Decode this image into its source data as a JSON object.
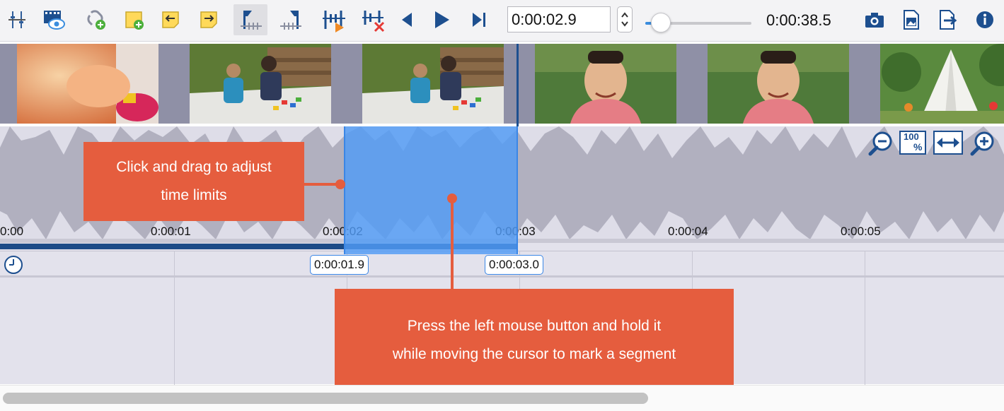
{
  "toolbar": {
    "icons": [
      "trim-icon",
      "preview-icon",
      "add-chapter-icon",
      "add-note-icon",
      "move-left-icon",
      "move-right-icon",
      "set-start-marker-icon",
      "set-end-marker-icon",
      "cut-segment-icon",
      "delete-segment-icon",
      "previous-icon",
      "play-icon",
      "skip-end-icon"
    ],
    "position_value": "0:00:02.9",
    "duration": "0:00:38.5",
    "volume_level": 0.12,
    "right_icons": [
      "camera-icon",
      "save-image-icon",
      "export-icon",
      "info-icon"
    ],
    "accent_color": "#1d4f8f"
  },
  "timeline": {
    "ruler_labels": [
      "0:00",
      "0:00:01",
      "0:00:02",
      "0:00:03",
      "0:00:04",
      "0:00:05"
    ],
    "selection_start": "0:00:01.9",
    "selection_end": "0:00:03.0",
    "zoom_100_label": "100",
    "zoom_100_pct": "%"
  },
  "callouts": {
    "adjust_line1": "Click and drag to adjust",
    "adjust_line2": "time limits",
    "mark_line1": "Press the left mouse button and hold it",
    "mark_line2": "while moving the cursor to mark a segment"
  },
  "colors": {
    "callout": "#e55d3e",
    "selection": "#509bf5",
    "playhead": "#1d4f8f"
  }
}
